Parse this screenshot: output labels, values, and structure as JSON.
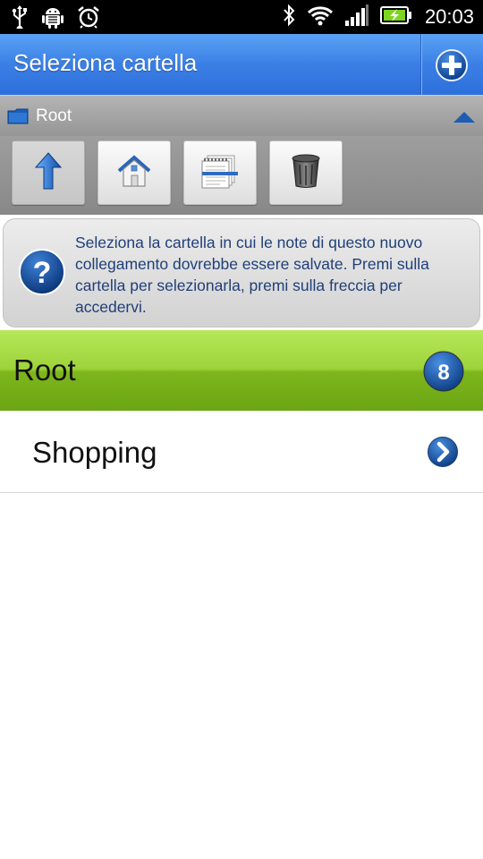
{
  "status_bar": {
    "time": "20:03",
    "icons": [
      "usb-icon",
      "android-debug-icon",
      "alarm-icon",
      "bluetooth-icon",
      "wifi-icon",
      "signal-icon",
      "battery-charging-icon"
    ]
  },
  "header": {
    "title": "Seleziona cartella",
    "add_icon": "plus-circle-icon"
  },
  "breadcrumb": {
    "label": "Root",
    "folder_icon": "folder-icon",
    "collapse_icon": "collapse-up-icon"
  },
  "toolbar": {
    "buttons": [
      {
        "icon": "up-arrow-icon"
      },
      {
        "icon": "home-icon"
      },
      {
        "icon": "notes-icon"
      },
      {
        "icon": "trash-icon"
      }
    ]
  },
  "info": {
    "text": "Seleziona la cartella in cui le note di questo nuovo collegamento dovrebbe essere salvate. Premi sulla cartella per selezionarla, premi sulla freccia per accedervi.",
    "icon": "help-icon"
  },
  "folder_header": {
    "label": "Root",
    "count": "8"
  },
  "folders": [
    {
      "label": "Shopping",
      "arrow_icon": "chevron-right-icon"
    }
  ],
  "colors": {
    "title_bar": "#3b7fe5",
    "folder_header": "#8fc62a",
    "info_text": "#1f3f79"
  }
}
